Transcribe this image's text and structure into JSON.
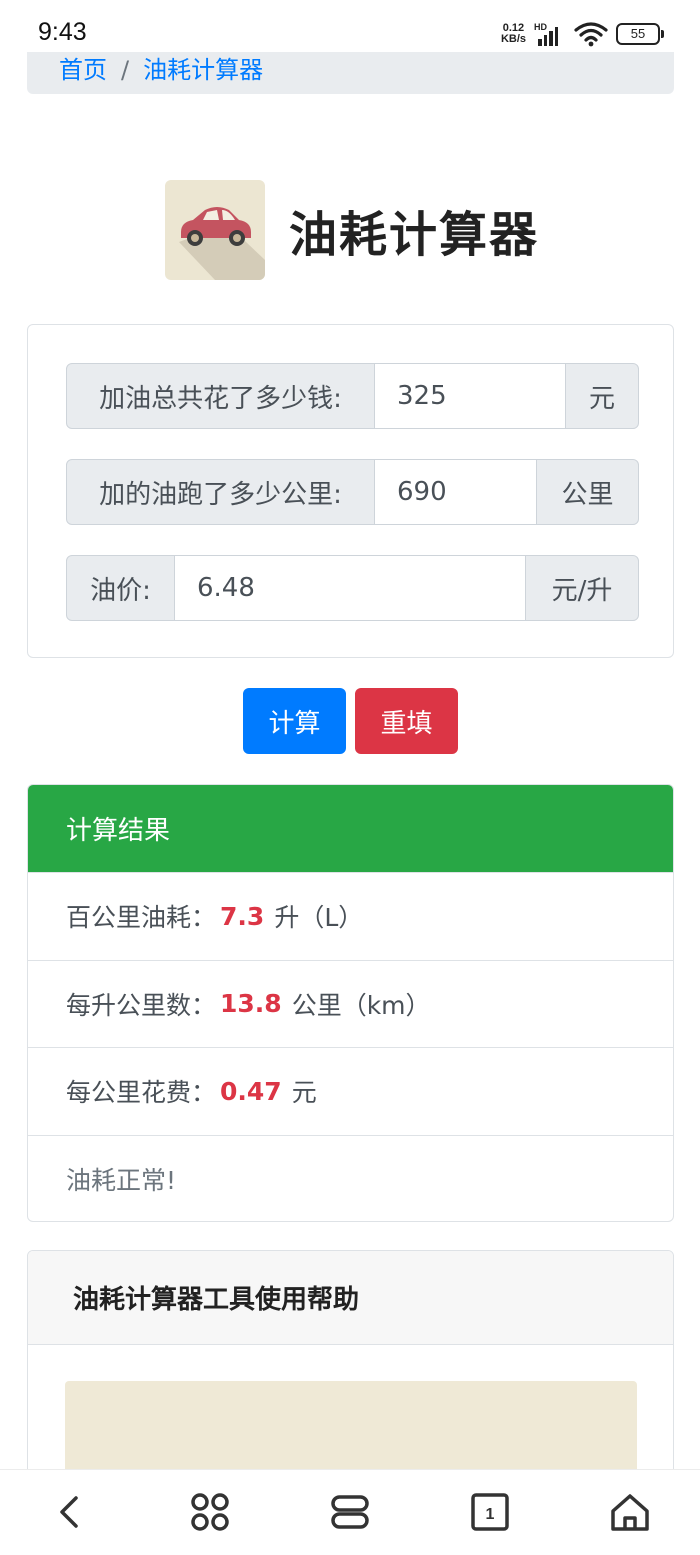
{
  "status_bar": {
    "time": "9:43",
    "net_speed_value": "0.12",
    "net_speed_unit": "KB/s",
    "network_label": "HD",
    "battery": "55",
    "icons": [
      "signal-icon",
      "wifi-icon",
      "battery-icon"
    ]
  },
  "breadcrumb": {
    "home": "首页",
    "separator": "/",
    "current": "油耗计算器"
  },
  "header": {
    "title": "油耗计算器",
    "icon": "car-icon"
  },
  "form": {
    "fields": [
      {
        "label": "加油总共花了多少钱:",
        "value": "325",
        "unit": "元"
      },
      {
        "label": "加的油跑了多少公里:",
        "value": "690",
        "unit": "公里"
      },
      {
        "label": "油价:",
        "value": "6.48",
        "unit": "元/升"
      }
    ]
  },
  "buttons": {
    "calculate": "计算",
    "reset": "重填"
  },
  "result": {
    "header": "计算结果",
    "rows": [
      {
        "label": "百公里油耗：",
        "value": "7.3",
        "unit": "升（L）"
      },
      {
        "label": "每升公里数：",
        "value": "13.8",
        "unit": "公里（km）"
      },
      {
        "label": "每公里花费：",
        "value": "0.47",
        "unit": "元"
      }
    ],
    "verdict": "油耗正常!"
  },
  "help": {
    "title": "油耗计算器工具使用帮助"
  },
  "bottom_nav": {
    "tab_count": "1",
    "icons": [
      "back-icon",
      "apps-icon",
      "menu-icon",
      "tabs-icon",
      "home-icon"
    ]
  },
  "colors": {
    "primary": "#007bff",
    "danger": "#dc3545",
    "success": "#28a745",
    "input_addon": "#e9ecef"
  }
}
